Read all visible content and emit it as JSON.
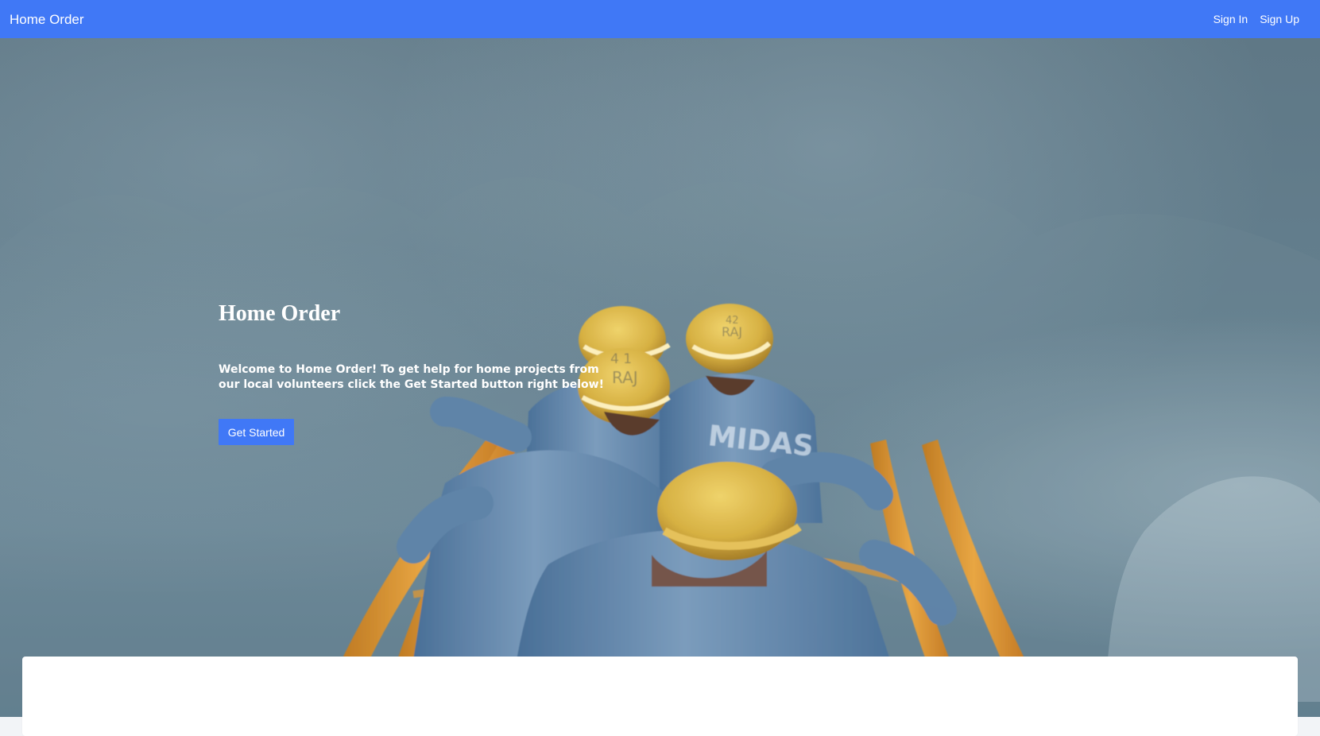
{
  "navbar": {
    "brand": "Home Order",
    "links": [
      {
        "label": "Sign In"
      },
      {
        "label": "Sign Up"
      }
    ],
    "background_color": "#4078f6"
  },
  "hero": {
    "title": "Home Order",
    "description": "Welcome to Home Order! To get help for home projects from our local volunteers click the Get Started button right below!",
    "button_label": "Get Started",
    "image_alt": "workers in helmets climbing a ladder"
  },
  "colors": {
    "accent": "#4078f6",
    "hero_overlay": "#637e8d",
    "panel": "#ffffff"
  }
}
